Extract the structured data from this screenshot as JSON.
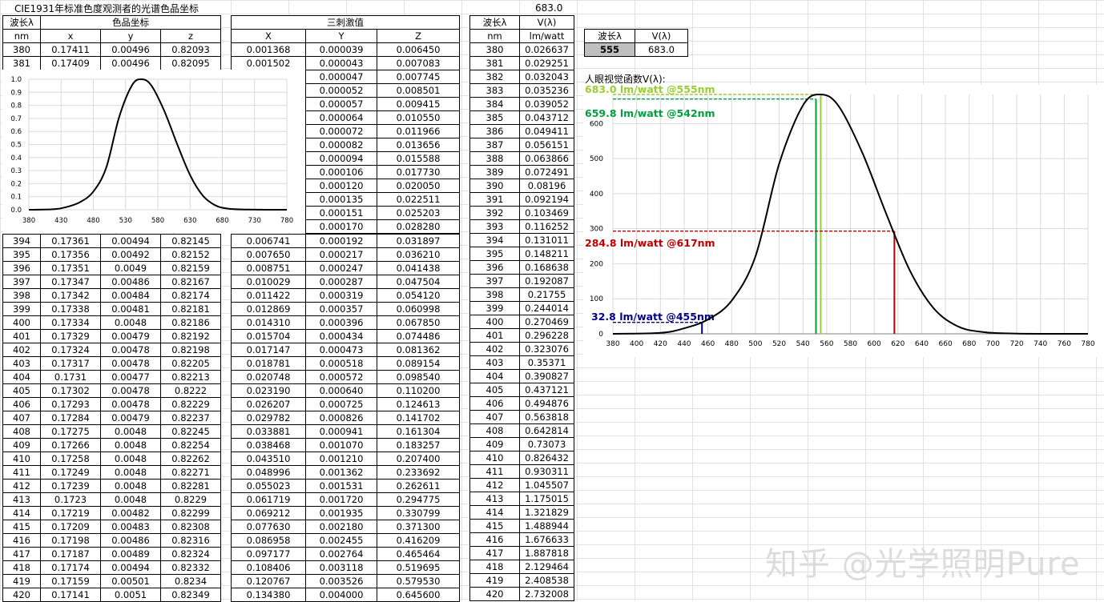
{
  "sheet": {
    "title": "CIE1931年标准色度观测者的光谱色品坐标",
    "top_value": "683.0",
    "headers": {
      "wl": "波长λ",
      "chroma": "色品坐标",
      "tristim": "三刺激值",
      "wl2": "波长λ",
      "v": "V(λ)",
      "nm": "nm",
      "x": "x",
      "y": "y",
      "z": "z",
      "X": "X",
      "Y": "Y",
      "Z": "Z",
      "nm2": "nm",
      "unit": "lm/watt"
    },
    "lookup": {
      "h1": "波长λ",
      "h2": "V(λ)",
      "wl": "555",
      "v": "683.0"
    },
    "chart2_title": "人眼视觉函数V(λ):",
    "watermark": "知乎 @光学照明Pure"
  },
  "chroma_rows_top": [
    [
      "380",
      "0.17411",
      "0.00496",
      "0.82093"
    ],
    [
      "381",
      "0.17409",
      "0.00496",
      "0.82095"
    ]
  ],
  "chroma_rows": [
    [
      "394",
      "0.17361",
      "0.00494",
      "0.82145"
    ],
    [
      "395",
      "0.17356",
      "0.00492",
      "0.82152"
    ],
    [
      "396",
      "0.17351",
      "0.0049",
      "0.82159"
    ],
    [
      "397",
      "0.17347",
      "0.00486",
      "0.82167"
    ],
    [
      "398",
      "0.17342",
      "0.00484",
      "0.82174"
    ],
    [
      "399",
      "0.17338",
      "0.00481",
      "0.82181"
    ],
    [
      "400",
      "0.17334",
      "0.0048",
      "0.82186"
    ],
    [
      "401",
      "0.17329",
      "0.00479",
      "0.82192"
    ],
    [
      "402",
      "0.17324",
      "0.00478",
      "0.82198"
    ],
    [
      "403",
      "0.17317",
      "0.00478",
      "0.82205"
    ],
    [
      "404",
      "0.1731",
      "0.00477",
      "0.82213"
    ],
    [
      "405",
      "0.17302",
      "0.00478",
      "0.8222"
    ],
    [
      "406",
      "0.17293",
      "0.00478",
      "0.82229"
    ],
    [
      "407",
      "0.17284",
      "0.00479",
      "0.82237"
    ],
    [
      "408",
      "0.17275",
      "0.0048",
      "0.82245"
    ],
    [
      "409",
      "0.17266",
      "0.0048",
      "0.82254"
    ],
    [
      "410",
      "0.17258",
      "0.0048",
      "0.82262"
    ],
    [
      "411",
      "0.17249",
      "0.0048",
      "0.82271"
    ],
    [
      "412",
      "0.17239",
      "0.0048",
      "0.82281"
    ],
    [
      "413",
      "0.1723",
      "0.0048",
      "0.8229"
    ],
    [
      "414",
      "0.17219",
      "0.00482",
      "0.82299"
    ],
    [
      "415",
      "0.17209",
      "0.00483",
      "0.82308"
    ],
    [
      "416",
      "0.17198",
      "0.00486",
      "0.82316"
    ],
    [
      "417",
      "0.17187",
      "0.00489",
      "0.82324"
    ],
    [
      "418",
      "0.17174",
      "0.00494",
      "0.82332"
    ],
    [
      "419",
      "0.17159",
      "0.00501",
      "0.8234"
    ],
    [
      "420",
      "0.17141",
      "0.0051",
      "0.82349"
    ]
  ],
  "tristim_rows_top": [
    [
      "0.001368",
      "0.000039",
      "0.006450"
    ],
    [
      "0.001502",
      "0.000043",
      "0.007083"
    ]
  ],
  "tristim_rows_mid": [
    [
      "0.000047",
      "0.007745"
    ],
    [
      "0.000052",
      "0.008501"
    ],
    [
      "0.000057",
      "0.009415"
    ],
    [
      "0.000064",
      "0.010550"
    ],
    [
      "0.000072",
      "0.011966"
    ],
    [
      "0.000082",
      "0.013656"
    ],
    [
      "0.000094",
      "0.015588"
    ],
    [
      "0.000106",
      "0.017730"
    ],
    [
      "0.000120",
      "0.020050"
    ],
    [
      "0.000135",
      "0.022511"
    ],
    [
      "0.000151",
      "0.025203"
    ],
    [
      "0.000170",
      "0.028280"
    ]
  ],
  "tristim_rows": [
    [
      "0.006741",
      "0.000192",
      "0.031897"
    ],
    [
      "0.007650",
      "0.000217",
      "0.036210"
    ],
    [
      "0.008751",
      "0.000247",
      "0.041438"
    ],
    [
      "0.010029",
      "0.000287",
      "0.047504"
    ],
    [
      "0.011422",
      "0.000319",
      "0.054120"
    ],
    [
      "0.012869",
      "0.000357",
      "0.060998"
    ],
    [
      "0.014310",
      "0.000396",
      "0.067850"
    ],
    [
      "0.015704",
      "0.000434",
      "0.074486"
    ],
    [
      "0.017147",
      "0.000473",
      "0.081362"
    ],
    [
      "0.018781",
      "0.000518",
      "0.089154"
    ],
    [
      "0.020748",
      "0.000572",
      "0.098540"
    ],
    [
      "0.023190",
      "0.000640",
      "0.110200"
    ],
    [
      "0.026207",
      "0.000725",
      "0.124613"
    ],
    [
      "0.029782",
      "0.000826",
      "0.141702"
    ],
    [
      "0.033881",
      "0.000941",
      "0.161304"
    ],
    [
      "0.038468",
      "0.001070",
      "0.183257"
    ],
    [
      "0.043510",
      "0.001210",
      "0.207400"
    ],
    [
      "0.048996",
      "0.001362",
      "0.233692"
    ],
    [
      "0.055023",
      "0.001531",
      "0.262611"
    ],
    [
      "0.061719",
      "0.001720",
      "0.294775"
    ],
    [
      "0.069212",
      "0.001935",
      "0.330799"
    ],
    [
      "0.077630",
      "0.002180",
      "0.371300"
    ],
    [
      "0.086958",
      "0.002455",
      "0.416209"
    ],
    [
      "0.097177",
      "0.002764",
      "0.465464"
    ],
    [
      "0.108406",
      "0.003118",
      "0.519695"
    ],
    [
      "0.120767",
      "0.003526",
      "0.579530"
    ],
    [
      "0.134380",
      "0.004000",
      "0.645600"
    ]
  ],
  "v_rows": [
    [
      "380",
      "0.026637"
    ],
    [
      "381",
      "0.029251"
    ],
    [
      "382",
      "0.032043"
    ],
    [
      "383",
      "0.035236"
    ],
    [
      "384",
      "0.039052"
    ],
    [
      "385",
      "0.043712"
    ],
    [
      "386",
      "0.049411"
    ],
    [
      "387",
      "0.056151"
    ],
    [
      "388",
      "0.063866"
    ],
    [
      "389",
      "0.072491"
    ],
    [
      "390",
      "0.08196"
    ],
    [
      "391",
      "0.092194"
    ],
    [
      "392",
      "0.103469"
    ],
    [
      "393",
      "0.116252"
    ],
    [
      "394",
      "0.131011"
    ],
    [
      "395",
      "0.148211"
    ],
    [
      "396",
      "0.168638"
    ],
    [
      "397",
      "0.192087"
    ],
    [
      "398",
      "0.21755"
    ],
    [
      "399",
      "0.244014"
    ],
    [
      "400",
      "0.270469"
    ],
    [
      "401",
      "0.296228"
    ],
    [
      "402",
      "0.323076"
    ],
    [
      "403",
      "0.35371"
    ],
    [
      "404",
      "0.390827"
    ],
    [
      "405",
      "0.437121"
    ],
    [
      "406",
      "0.494876"
    ],
    [
      "407",
      "0.563818"
    ],
    [
      "408",
      "0.642814"
    ],
    [
      "409",
      "0.73073"
    ],
    [
      "410",
      "0.826432"
    ],
    [
      "411",
      "0.930311"
    ],
    [
      "412",
      "1.045507"
    ],
    [
      "413",
      "1.175015"
    ],
    [
      "414",
      "1.321829"
    ],
    [
      "415",
      "1.488944"
    ],
    [
      "416",
      "1.676633"
    ],
    [
      "417",
      "1.887818"
    ],
    [
      "418",
      "2.129464"
    ],
    [
      "419",
      "2.408538"
    ],
    [
      "420",
      "2.732008"
    ]
  ],
  "chart_data": [
    {
      "type": "line",
      "xlim": [
        380,
        780
      ],
      "ylim": [
        0,
        1.0
      ],
      "x_ticks": [
        "380",
        "430",
        "480",
        "530",
        "580",
        "630",
        "680",
        "730",
        "780"
      ],
      "y_ticks": [
        "0.0",
        "0.1",
        "0.2",
        "0.3",
        "0.4",
        "0.5",
        "0.6",
        "0.7",
        "0.8",
        "0.9",
        "1.0"
      ],
      "grid": true,
      "series": [
        {
          "x": [
            380,
            420,
            440,
            460,
            480,
            500,
            520,
            540,
            555,
            570,
            590,
            610,
            630,
            650,
            670,
            690,
            720,
            780
          ],
          "y": [
            0.0,
            0.004,
            0.023,
            0.06,
            0.139,
            0.323,
            0.71,
            0.954,
            1.0,
            0.952,
            0.757,
            0.503,
            0.265,
            0.107,
            0.032,
            0.0082,
            0.0011,
            0.0
          ]
        }
      ],
      "color": "#000000"
    },
    {
      "type": "line",
      "title": "人眼视觉函数V(λ):",
      "xlim": [
        380,
        780
      ],
      "ylim": [
        0,
        683
      ],
      "x_ticks": [
        "380",
        "400",
        "420",
        "440",
        "460",
        "480",
        "500",
        "520",
        "540",
        "560",
        "580",
        "600",
        "620",
        "640",
        "660",
        "680",
        "700",
        "720",
        "740",
        "760",
        "780"
      ],
      "y_ticks": [
        "0",
        "100",
        "200",
        "300",
        "400",
        "500",
        "600"
      ],
      "grid": true,
      "series": [
        {
          "x": [
            380,
            420,
            440,
            460,
            480,
            500,
            520,
            540,
            555,
            570,
            590,
            610,
            630,
            650,
            670,
            690,
            720,
            780
          ],
          "y": [
            0.0,
            2.7,
            15.7,
            41.0,
            94.9,
            220.6,
            485.0,
            651.6,
            683.0,
            650.2,
            517.0,
            343.5,
            181.0,
            73.1,
            21.9,
            5.6,
            0.75,
            0.0
          ]
        }
      ],
      "color": "#000000",
      "annotations": [
        {
          "label": "683.0 lm/watt @555nm",
          "wl": 555,
          "value": 683.0,
          "color": "#9acd32"
        },
        {
          "label": "659.8 lm/watt @542nm",
          "wl": 551,
          "value": 670.0,
          "color": "#00a040"
        },
        {
          "label": "284.8 lm/watt @617nm",
          "wl": 617,
          "value": 293.0,
          "color": "#c00000"
        },
        {
          "label": "32.8 lm/watt @455nm",
          "wl": 455,
          "value": 32.8,
          "color": "#00008b"
        }
      ]
    }
  ]
}
